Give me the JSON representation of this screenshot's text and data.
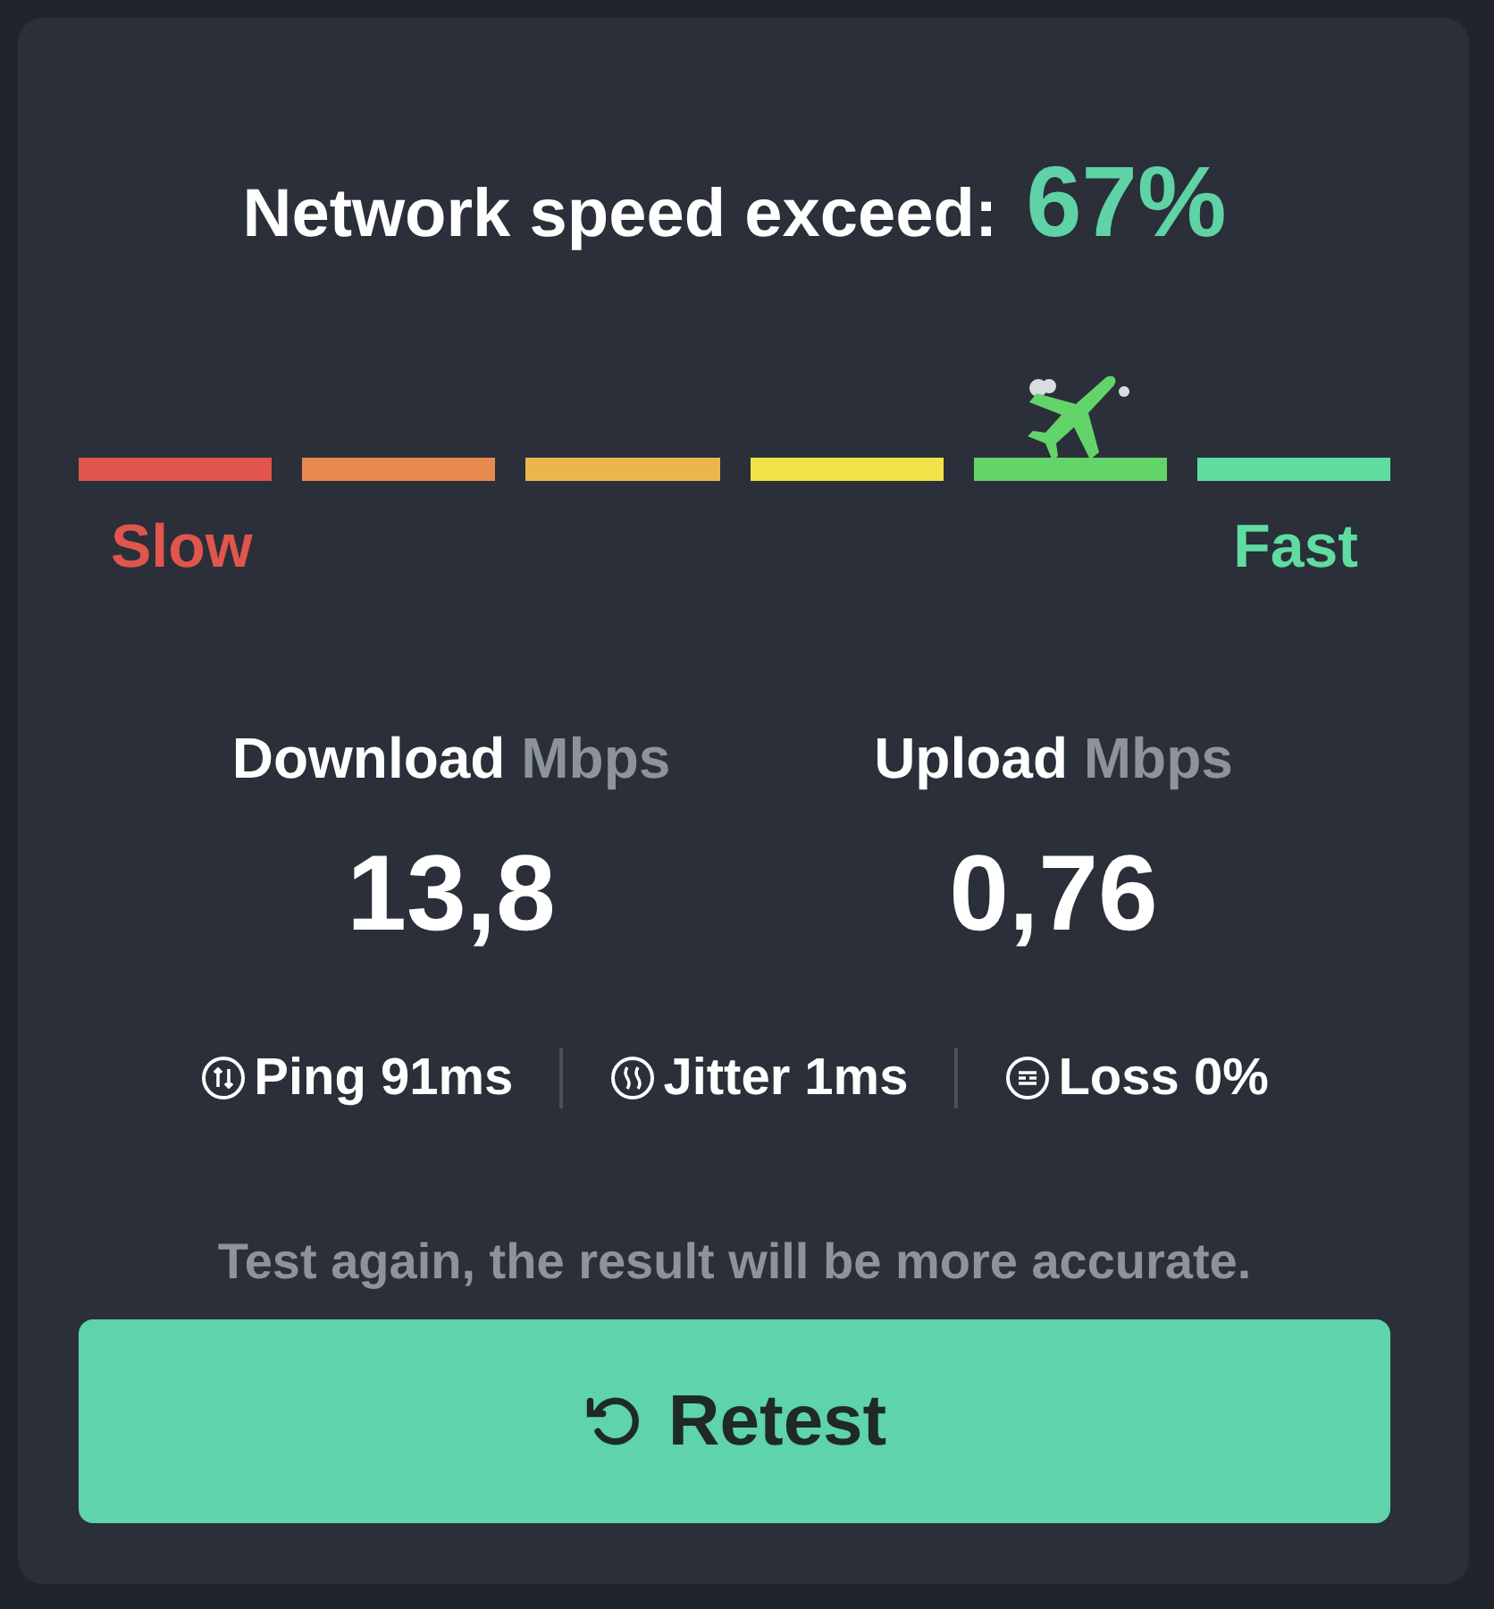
{
  "title": {
    "text": "Network speed exceed:",
    "percent": "67%"
  },
  "gauge": {
    "segments": [
      {
        "color": "#e0554c",
        "selected": false
      },
      {
        "color": "#e88a4e",
        "selected": false
      },
      {
        "color": "#ecb64c",
        "selected": false
      },
      {
        "color": "#f2e24a",
        "selected": false
      },
      {
        "color": "#63d46a",
        "selected": true
      },
      {
        "color": "#5fdca0",
        "selected": false
      }
    ],
    "slow_label": "Slow",
    "fast_label": "Fast"
  },
  "stats": [
    {
      "label": "Download",
      "unit": "Mbps",
      "value": "13,8"
    },
    {
      "label": "Upload",
      "unit": "Mbps",
      "value": "0,76"
    }
  ],
  "metrics": [
    {
      "kind": "ping",
      "text": "Ping 91ms"
    },
    {
      "kind": "jitter",
      "text": "Jitter 1ms"
    },
    {
      "kind": "loss",
      "text": "Loss 0%"
    }
  ],
  "note": "Test again, the result will be more accurate.",
  "button": {
    "label": "Retest"
  }
}
